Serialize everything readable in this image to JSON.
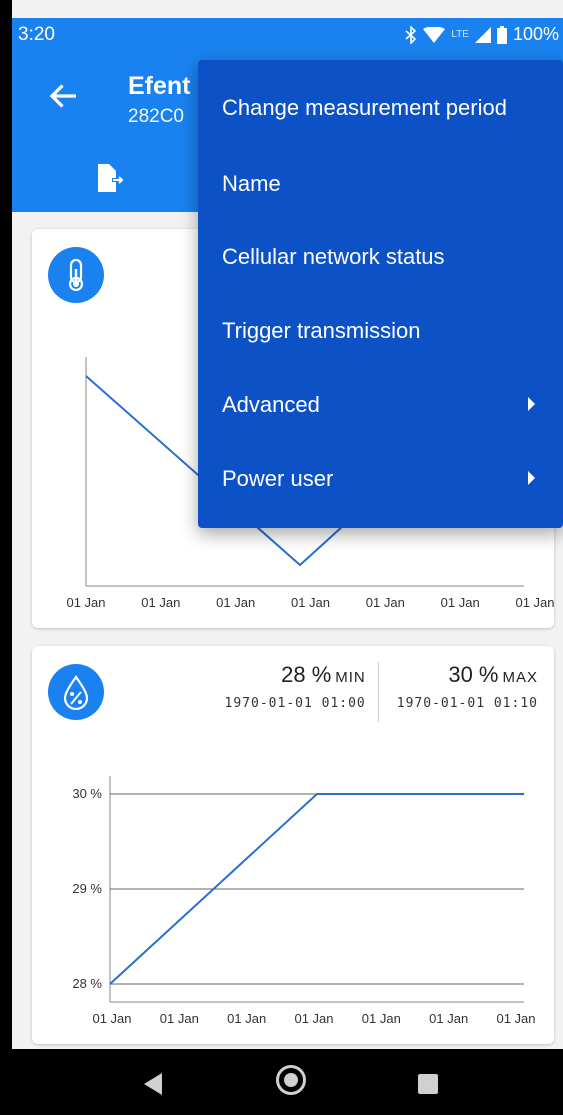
{
  "status_bar": {
    "time": "3:20",
    "network": "LTE",
    "battery": "100%"
  },
  "app_bar": {
    "title": "Efent",
    "subtitle": "282C0"
  },
  "menu": {
    "items": [
      {
        "label": "Change measurement period",
        "has_submenu": false
      },
      {
        "label": "Name",
        "has_submenu": false
      },
      {
        "label": "Cellular network status",
        "has_submenu": false
      },
      {
        "label": "Trigger transmission",
        "has_submenu": false
      },
      {
        "label": "Advanced",
        "has_submenu": true
      },
      {
        "label": "Power user",
        "has_submenu": true
      }
    ]
  },
  "temperature_card": {
    "icon": "thermometer-icon"
  },
  "humidity_card": {
    "icon": "humidity-icon",
    "min": {
      "value": "28 %",
      "label": "MIN",
      "date": "1970-01-01 01:00"
    },
    "max": {
      "value": "30 %",
      "label": "MAX",
      "date": "1970-01-01 01:10"
    }
  },
  "colors": {
    "accent": "#1a82f0",
    "menu_bg": "#0c52c6",
    "line": "#2a6fd0"
  },
  "chart_data": [
    {
      "type": "line",
      "x": [
        "01 Jan",
        "01 Jan",
        "01 Jan",
        "01 Jan",
        "01 Jan",
        "01 Jan",
        "01 Jan"
      ],
      "series": [
        {
          "values": [
            1.0,
            null,
            null,
            0.0,
            null,
            null,
            null
          ]
        }
      ],
      "grid": false
    },
    {
      "type": "line",
      "x": [
        "01 Jan",
        "01 Jan",
        "01 Jan",
        "01 Jan",
        "01 Jan",
        "01 Jan",
        "01 Jan"
      ],
      "yticks": [
        "28 %",
        "29 %",
        "30 %"
      ],
      "ylim": [
        28,
        30
      ],
      "series": [
        {
          "values": [
            28,
            29,
            30,
            30,
            30,
            30,
            30
          ]
        }
      ],
      "grid": true
    }
  ]
}
